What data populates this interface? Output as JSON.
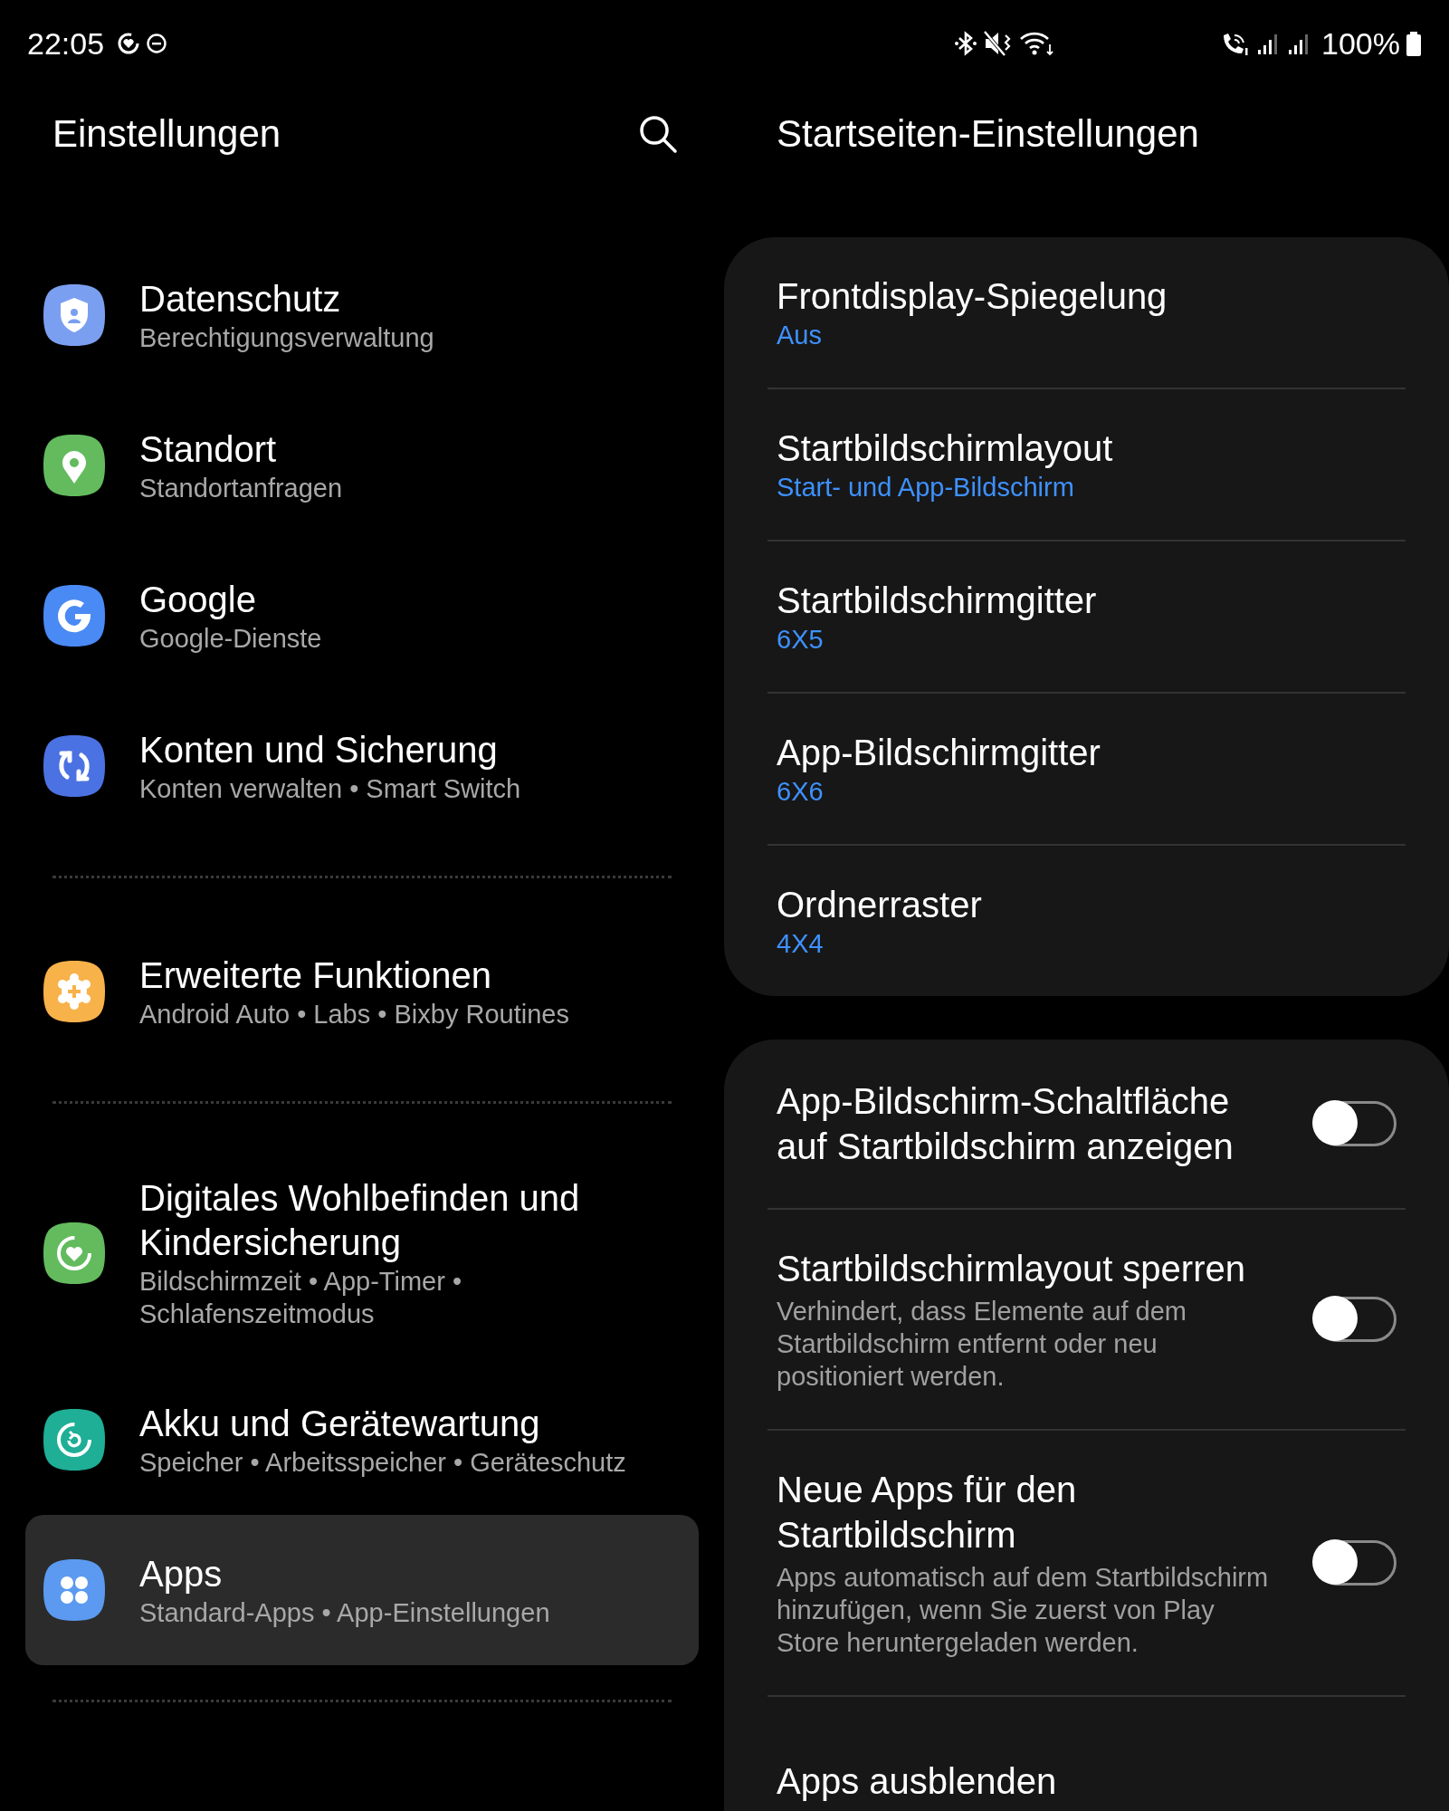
{
  "status_bar": {
    "time": "22:05",
    "battery": "100%"
  },
  "left": {
    "title": "Einstellungen",
    "groups": [
      [
        {
          "title": "Datenschutz",
          "subtitle": "Berechtigungsverwaltung",
          "color": "#7b9ff0",
          "selected": false
        },
        {
          "title": "Standort",
          "subtitle": "Standortanfragen",
          "color": "#63bb5e",
          "selected": false
        },
        {
          "title": "Google",
          "subtitle": "Google-Dienste",
          "color": "#4a8af4",
          "selected": false
        },
        {
          "title": "Konten und Sicherung",
          "subtitle": "Konten verwalten • Smart Switch",
          "color": "#4b72e2",
          "selected": false
        }
      ],
      [
        {
          "title": "Erweiterte Funktionen",
          "subtitle": "Android Auto • Labs • Bixby Routines",
          "color": "#f8b24a",
          "selected": false
        }
      ],
      [
        {
          "title": "Digitales Wohlbefinden und Kindersicherung",
          "subtitle": "Bildschirmzeit • App-Timer • Schlafenszeitmodus",
          "color": "#63bb5e",
          "selected": false
        },
        {
          "title": "Akku und Gerätewartung",
          "subtitle": "Speicher • Arbeitsspeicher • Geräteschutz",
          "color": "#1eaf96",
          "selected": false
        },
        {
          "title": "Apps",
          "subtitle": "Standard-Apps • App-Einstellungen",
          "color": "#5b9af0",
          "selected": true
        }
      ]
    ]
  },
  "right": {
    "title": "Startseiten-Einstellungen",
    "cards": [
      {
        "rows": [
          {
            "kind": "value",
            "title": "Frontdisplay-Spiegelung",
            "value": "Aus"
          },
          {
            "kind": "value",
            "title": "Startbildschirmlayout",
            "value": "Start- und App-Bildschirm"
          },
          {
            "kind": "value",
            "title": "Startbildschirmgitter",
            "value": "6X5"
          },
          {
            "kind": "value",
            "title": "App-Bildschirmgitter",
            "value": "6X6"
          },
          {
            "kind": "value",
            "title": "Ordnerraster",
            "value": "4X4"
          }
        ]
      },
      {
        "rows": [
          {
            "kind": "toggle",
            "title": "App-Bildschirm-Schaltfläche auf Startbildschirm anzeigen",
            "on": false
          },
          {
            "kind": "toggle",
            "title": "Startbildschirmlayout sperren",
            "description": "Verhindert, dass Elemente auf dem Startbildschirm entfernt oder neu positioniert werden.",
            "on": false
          },
          {
            "kind": "toggle",
            "title": "Neue Apps für den Startbildschirm",
            "description": "Apps automatisch auf dem Startbildschirm hinzufügen, wenn Sie zuerst von Play Store heruntergeladen werden.",
            "on": false
          },
          {
            "kind": "plain",
            "title": "Apps ausblenden"
          }
        ]
      }
    ]
  }
}
